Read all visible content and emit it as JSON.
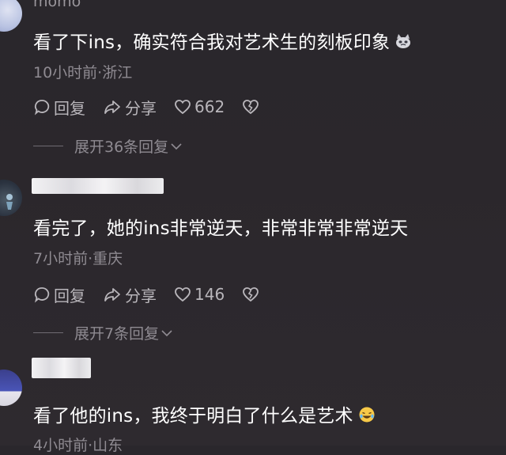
{
  "comments": [
    {
      "username": "momo",
      "text": "看了下ins，确实符合我对艺术生的刻板印象",
      "emoji": "cat-emoji",
      "meta": "10小时前·浙江",
      "reply_label": "回复",
      "share_label": "分享",
      "likes": "662",
      "expand_label": "展开36条回复"
    },
    {
      "username": "",
      "text": "看完了，她的ins非常逆天，非常非常非常逆天",
      "meta": "7小时前·重庆",
      "reply_label": "回复",
      "share_label": "分享",
      "likes": "146",
      "expand_label": "展开7条回复"
    },
    {
      "username": "",
      "text": "看了他的ins，我终于明白了什么是艺术",
      "emoji": "laughing-crying-emoji",
      "meta": "4小时前·山东"
    }
  ]
}
